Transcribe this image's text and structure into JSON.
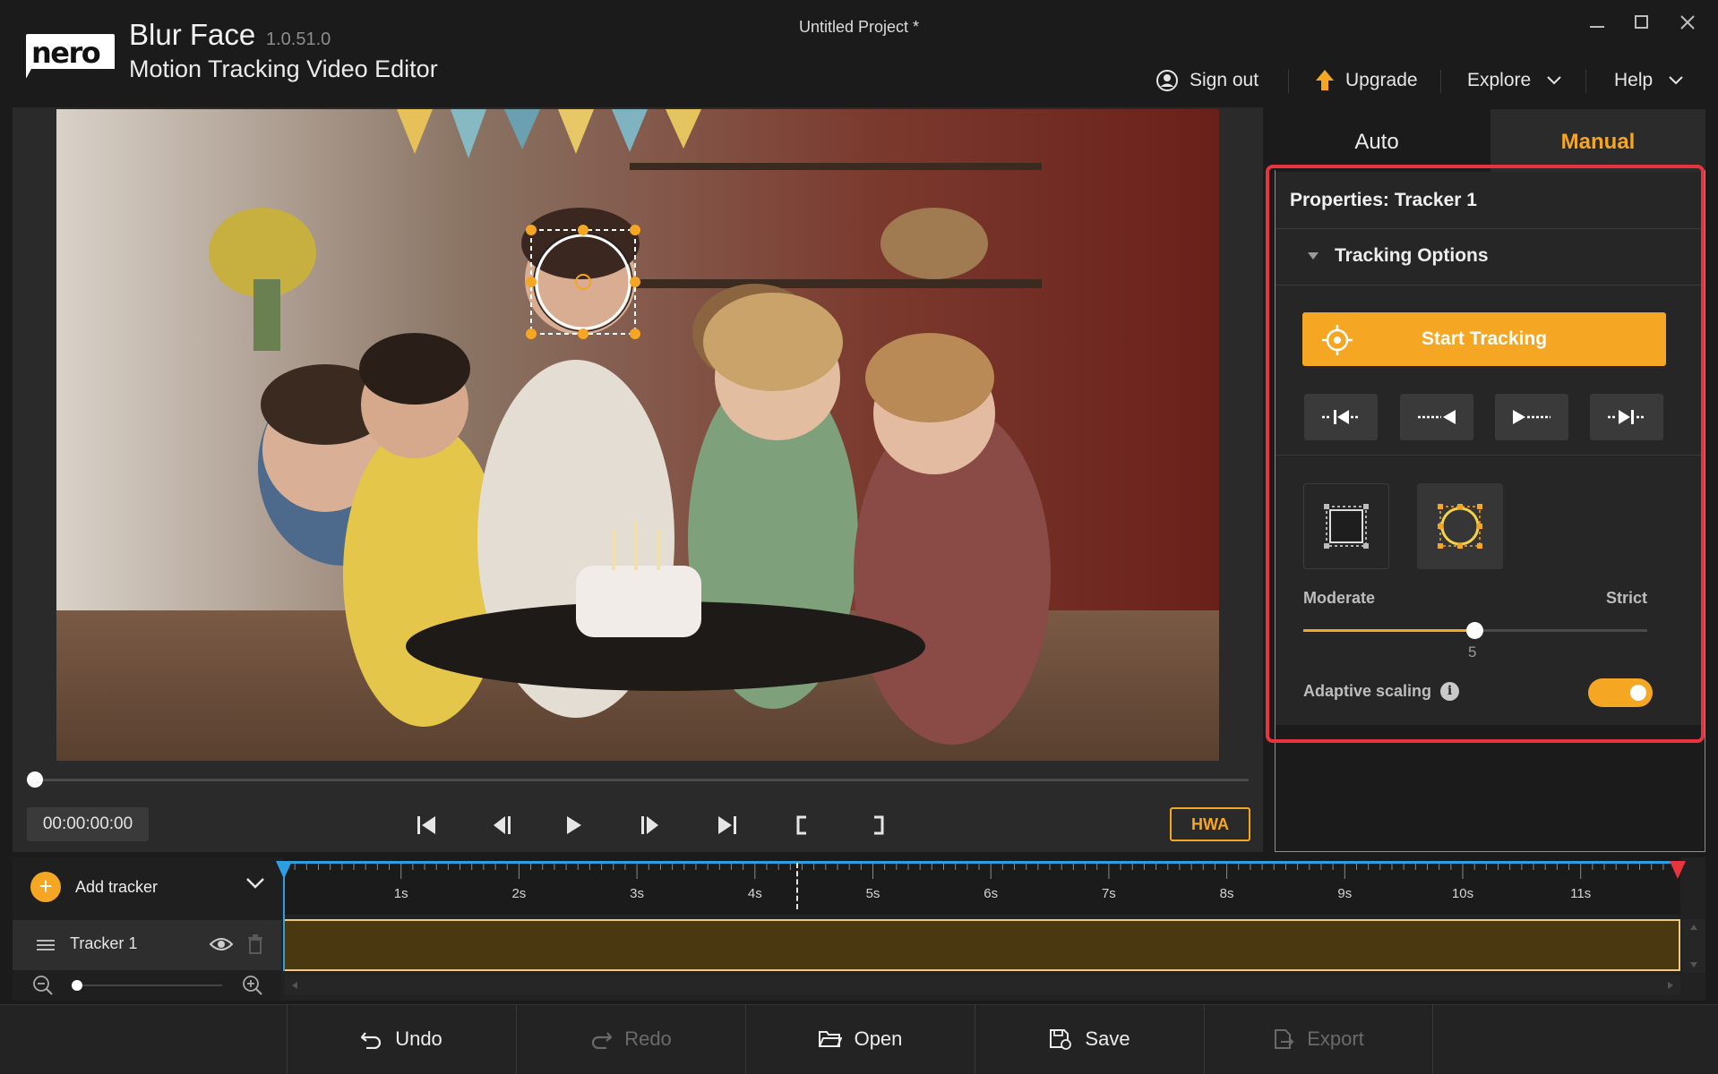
{
  "app": {
    "logo_text": "nero",
    "title": "Blur Face",
    "version": "1.0.51.0",
    "subtitle": "Motion Tracking Video Editor",
    "project_title": "Untitled Project *"
  },
  "top_nav": {
    "sign_out": "Sign out",
    "upgrade": "Upgrade",
    "explore": "Explore",
    "help": "Help"
  },
  "player": {
    "timecode": "00:00:00:00",
    "hwa_label": "HWA",
    "scrub_position": 0
  },
  "mode_tabs": {
    "auto": "Auto",
    "manual": "Manual",
    "active": "Manual"
  },
  "properties": {
    "title": "Properties:  Tracker 1",
    "section": "Tracking Options",
    "start_tracking": "Start Tracking",
    "shape_selected": "ellipse",
    "sensitivity": {
      "min_label": "Moderate",
      "max_label": "Strict",
      "value": "5",
      "fraction": 0.5
    },
    "adaptive_scaling": {
      "label": "Adaptive scaling",
      "enabled": true
    }
  },
  "timeline": {
    "add_tracker": "Add tracker",
    "tracks": [
      {
        "name": "Tracker 1",
        "visible": true
      }
    ],
    "ticks": [
      "1s",
      "2s",
      "3s",
      "4s",
      "5s",
      "6s",
      "7s",
      "8s",
      "9s",
      "10s",
      "11s"
    ]
  },
  "bottom_toolbar": {
    "undo": "Undo",
    "redo": "Redo",
    "open": "Open",
    "save": "Save",
    "export": "Export"
  },
  "colors": {
    "accent": "#f5a623",
    "highlight": "#e8343e",
    "playhead": "#2d9ee0",
    "track_fill": "#4a3810"
  }
}
